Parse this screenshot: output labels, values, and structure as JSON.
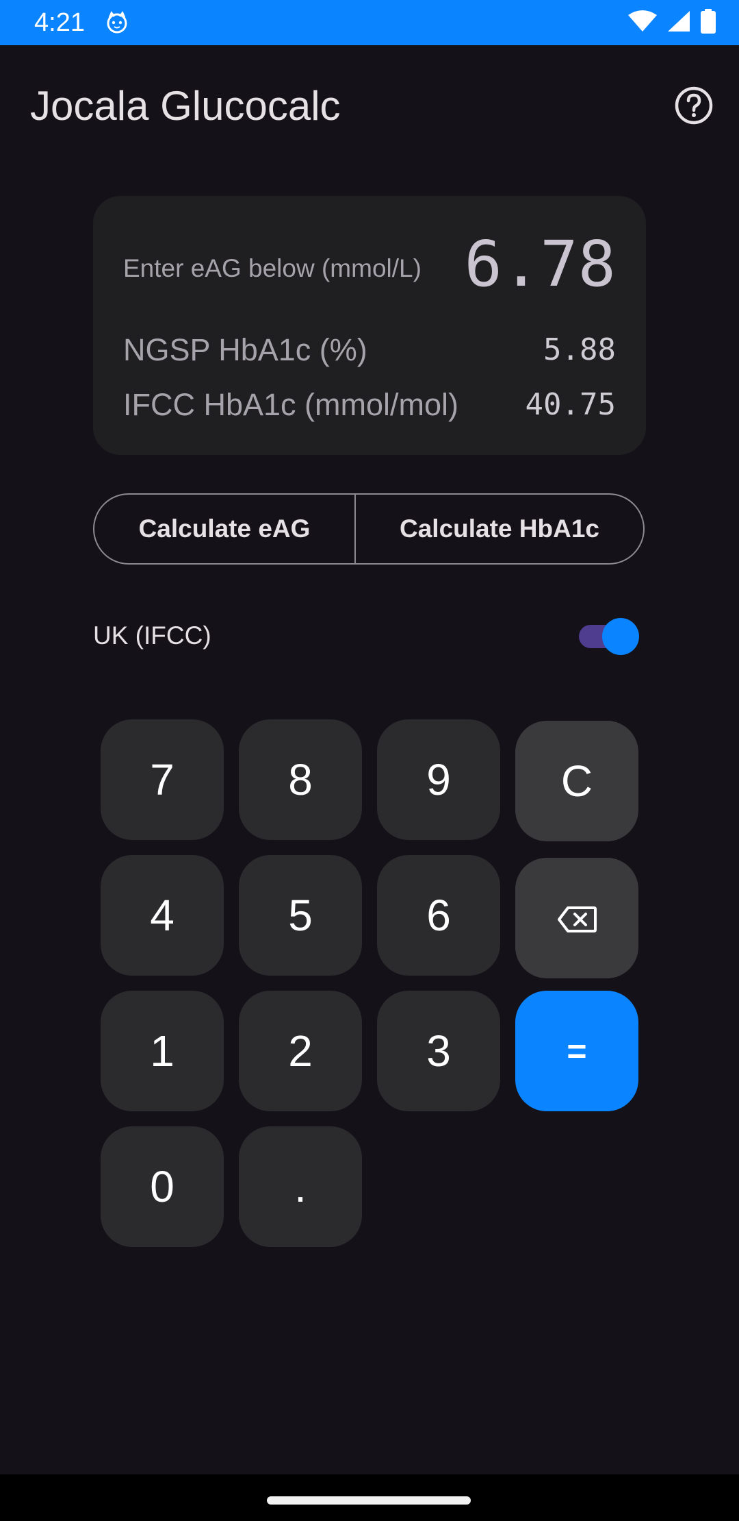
{
  "status_bar": {
    "time": "4:21",
    "icons": [
      "cat-face-icon",
      "wifi-icon",
      "signal-icon",
      "battery-icon"
    ],
    "background_color": "#0a84ff"
  },
  "app_bar": {
    "title": "Jocala Glucocalc",
    "help_icon": "help-circle-icon"
  },
  "result_card": {
    "prompt": "Enter eAG below (mmol/L)",
    "eag_value": "6.78",
    "ngsp_label": "NGSP HbA1c (%)",
    "ngsp_value": "5.88",
    "ifcc_label": "IFCC HbA1c (mmol/mol)",
    "ifcc_value": "40.75"
  },
  "mode_buttons": {
    "calculate_eag": "Calculate eAG",
    "calculate_hba1c": "Calculate HbA1c"
  },
  "region_toggle": {
    "label": "UK (IFCC)",
    "checked": true,
    "thumb_color": "#0a84ff",
    "track_color": "#4f3d8f"
  },
  "keypad": {
    "k7": "7",
    "k8": "8",
    "k9": "9",
    "clear": "C",
    "k4": "4",
    "k5": "5",
    "k6": "6",
    "k1": "1",
    "k2": "2",
    "k3": "3",
    "equals": "=",
    "k0": "0",
    "decimal": ".",
    "backspace_icon": "backspace-icon",
    "accent_color": "#0a84ff"
  }
}
